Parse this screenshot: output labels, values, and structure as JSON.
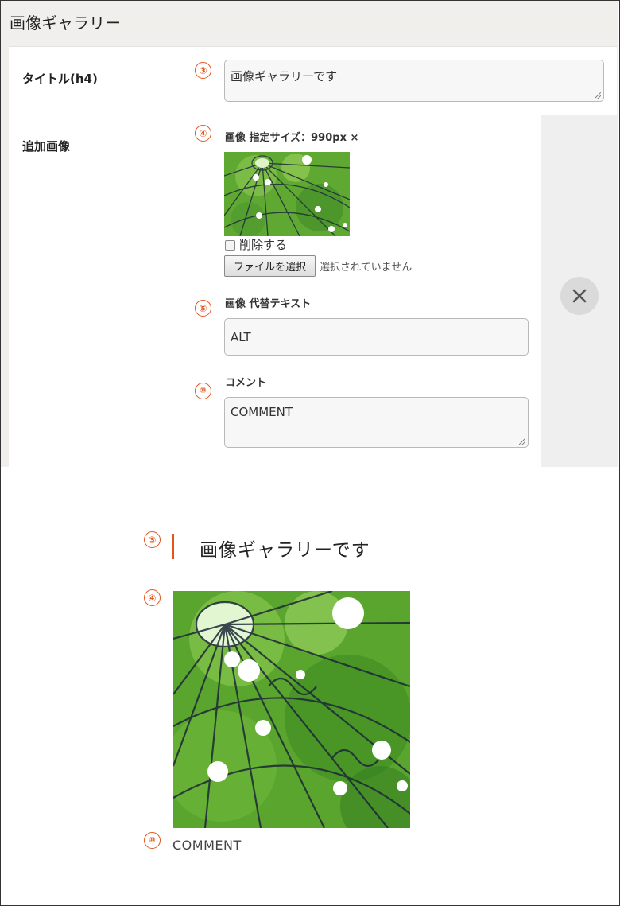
{
  "admin": {
    "panel_title": "画像ギャラリー",
    "title_field": {
      "label": "タイトル(h4)",
      "marker": "③",
      "value": "画像ギャラリーです"
    },
    "image_field": {
      "label": "追加画像",
      "marker": "④",
      "size_label": "画像 指定サイズ：990px ×",
      "delete_label": "削除する",
      "delete_checked": false,
      "file_button": "ファイルを選択",
      "file_status": "選択されていません"
    },
    "alt_field": {
      "marker": "⑤",
      "label": "画像 代替テキスト",
      "value": "ALT"
    },
    "comment_field": {
      "marker": "⑩",
      "label": "コメント",
      "value": "COMMENT"
    },
    "remove_icon": "close-icon"
  },
  "preview": {
    "title_marker": "③",
    "title": "画像ギャラリーです",
    "image_marker": "④",
    "comment_marker": "⑩",
    "comment": "COMMENT"
  },
  "colors": {
    "accent": "#e2551e",
    "panel_bg": "#f0efeb",
    "foliage": "#5fa832"
  }
}
